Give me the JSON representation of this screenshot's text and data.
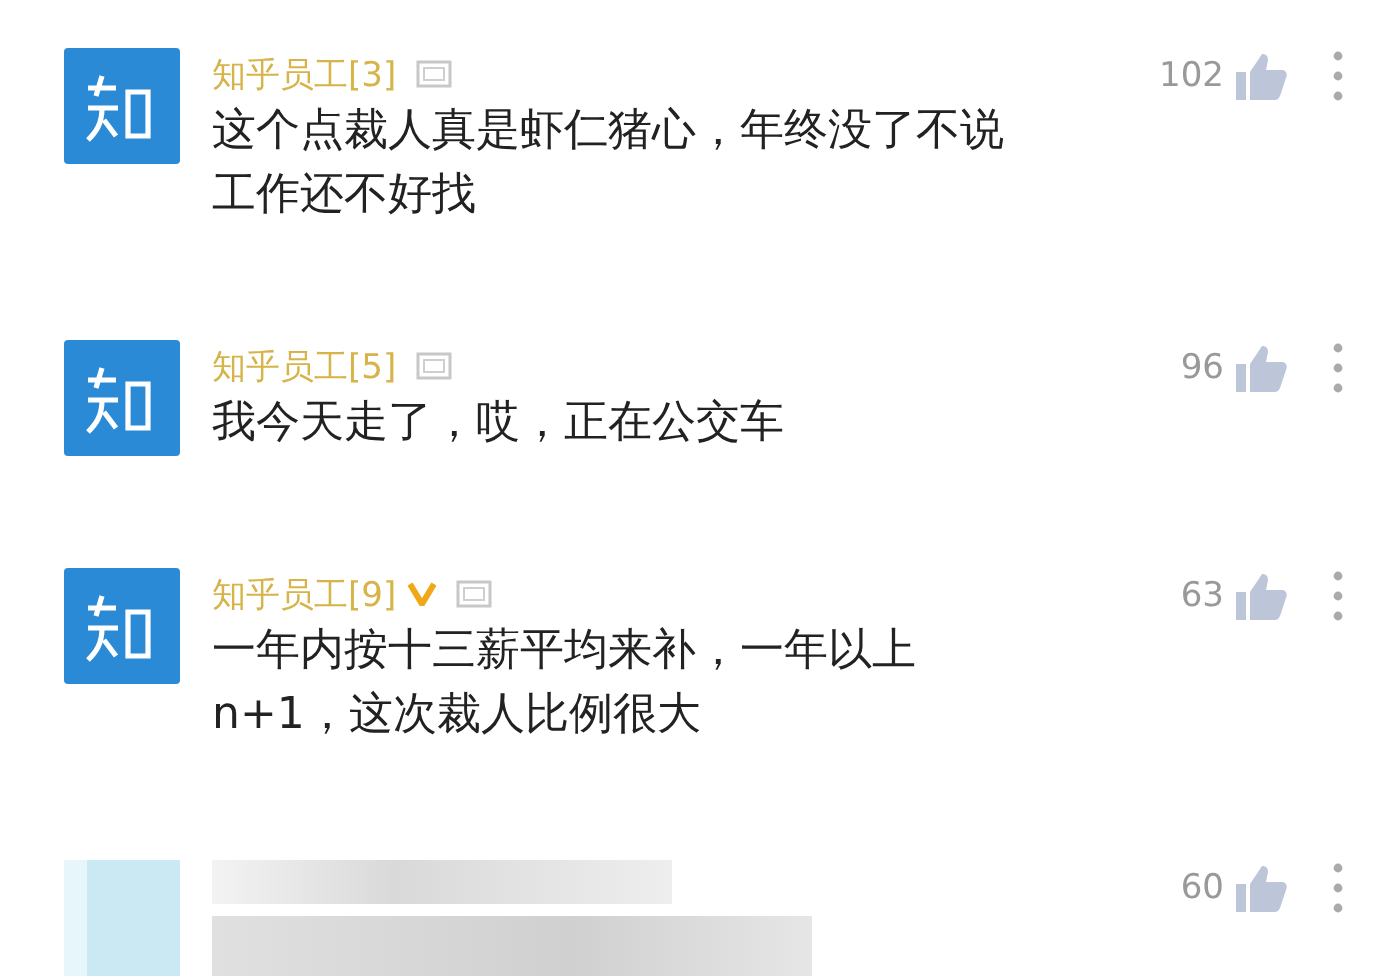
{
  "comments": [
    {
      "kind": "comment",
      "name": "知乎员工[3]",
      "verified": false,
      "text": "这个点裁人真是虾仁猪心，年终没了不说工作还不好找",
      "likes": "102"
    },
    {
      "kind": "comment",
      "name": "知乎员工[5]",
      "verified": false,
      "text": "我今天走了，哎，正在公交车",
      "likes": "96"
    },
    {
      "kind": "comment",
      "name": "知乎员工[9]",
      "verified": true,
      "text": "一年内按十三薪平均来补，一年以上n+1，这次裁人比例很大",
      "likes": "63"
    },
    {
      "kind": "blurred",
      "likes": "60"
    }
  ]
}
